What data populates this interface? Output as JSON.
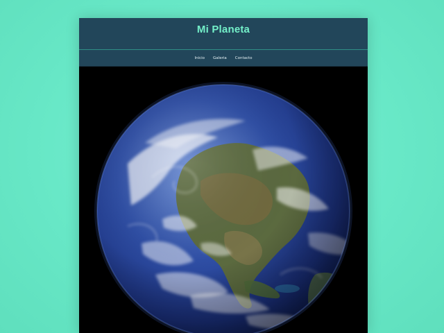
{
  "site": {
    "title": "Mi Planeta"
  },
  "nav": {
    "items": [
      {
        "label": "Inicio"
      },
      {
        "label": "Galeria"
      },
      {
        "label": "Contacto"
      }
    ]
  },
  "hero": {
    "image": "earth-globe"
  },
  "colors": {
    "background": "#67e8c6",
    "header": "#22465a",
    "title": "#74f0c9",
    "nav_text": "#e6f2f5",
    "hero_bg": "#000000"
  }
}
